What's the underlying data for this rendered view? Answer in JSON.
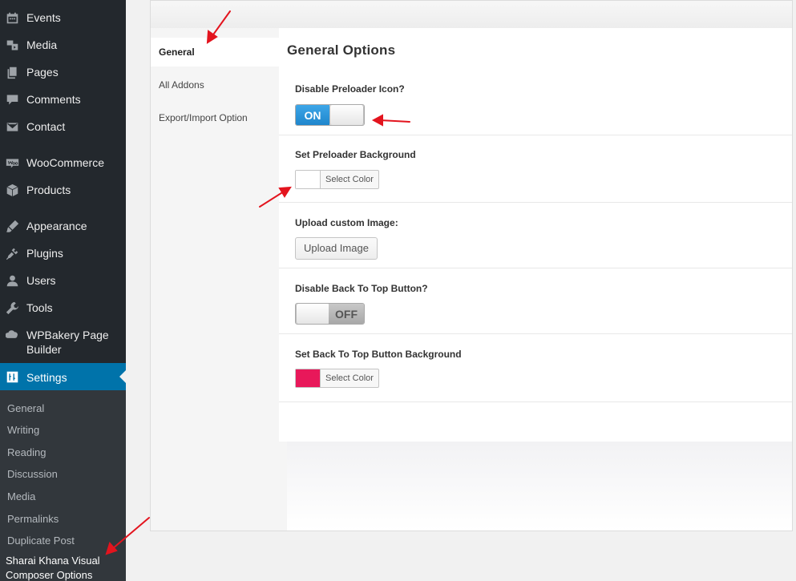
{
  "admin_menu": {
    "items": [
      {
        "label": "Events",
        "icon": "calendar-icon"
      },
      {
        "label": "Media",
        "icon": "media-icon"
      },
      {
        "label": "Pages",
        "icon": "pages-icon"
      },
      {
        "label": "Comments",
        "icon": "comments-icon"
      },
      {
        "label": "Contact",
        "icon": "envelope-icon"
      },
      {
        "label": "WooCommerce",
        "icon": "woocommerce-icon"
      },
      {
        "label": "Products",
        "icon": "box-icon"
      },
      {
        "label": "Appearance",
        "icon": "brush-icon"
      },
      {
        "label": "Plugins",
        "icon": "plug-icon"
      },
      {
        "label": "Users",
        "icon": "users-icon"
      },
      {
        "label": "Tools",
        "icon": "wrench-icon"
      },
      {
        "label": "WPBakery Page Builder",
        "icon": "wpbakery-icon"
      },
      {
        "label": "Settings",
        "icon": "settings-icon",
        "current": true
      }
    ],
    "submenu": [
      "General",
      "Writing",
      "Reading",
      "Discussion",
      "Media",
      "Permalinks",
      "Duplicate Post",
      "Sharai Khana Visual Composer Options"
    ]
  },
  "tabs": [
    {
      "label": "General",
      "active": true
    },
    {
      "label": "All Addons"
    },
    {
      "label": "Export/Import Option"
    }
  ],
  "section_title": "General Options",
  "options": {
    "preloader_icon": {
      "label": "Disable Preloader Icon?",
      "state": "ON"
    },
    "preloader_bg": {
      "label": "Set Preloader Background",
      "button": "Select Color",
      "color": "#ffffff"
    },
    "custom_image": {
      "label": "Upload custom Image:",
      "button": "Upload Image"
    },
    "back_to_top": {
      "label": "Disable Back To Top Button?",
      "state": "OFF"
    },
    "back_to_top_bg": {
      "label": "Set Back To Top Button Background",
      "button": "Select Color",
      "color": "#e8185a"
    }
  },
  "colors": {
    "admin_bg": "#23282d",
    "submenu_bg": "#32373c",
    "accent": "#0073aa",
    "switch_on": "#2a92d8",
    "annotation_arrow": "#e3141e"
  }
}
